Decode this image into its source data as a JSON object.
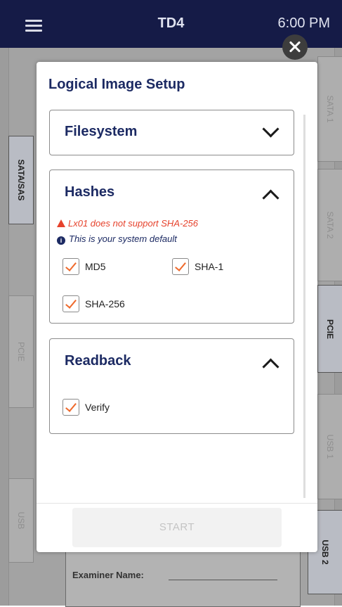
{
  "app": {
    "title": "TD4",
    "time": "6:00 PM"
  },
  "background": {
    "tabs_left": [
      "SATA/SAS",
      "PCIE",
      "USB"
    ],
    "tabs_right": [
      "SATA 1",
      "SATA 2",
      "PCIE",
      "USB 1",
      "USB 2"
    ],
    "examiner_label": "Examiner Name:"
  },
  "modal": {
    "title": "Logical Image Setup",
    "sections": {
      "filesystem": {
        "title": "Filesystem",
        "expanded": false
      },
      "hashes": {
        "title": "Hashes",
        "expanded": true,
        "warning": "Lx01 does not support SHA-256",
        "info": "This is your system default",
        "options": [
          {
            "label": "MD5",
            "checked": true
          },
          {
            "label": "SHA-1",
            "checked": true
          },
          {
            "label": "SHA-256",
            "checked": true
          }
        ]
      },
      "readback": {
        "title": "Readback",
        "expanded": true,
        "options": [
          {
            "label": "Verify",
            "checked": true
          }
        ]
      }
    },
    "start_label": "START"
  },
  "colors": {
    "topbar": "#151b47",
    "heading": "#1c2a63",
    "warning": "#e6422c",
    "check": "#ef6a2c"
  }
}
